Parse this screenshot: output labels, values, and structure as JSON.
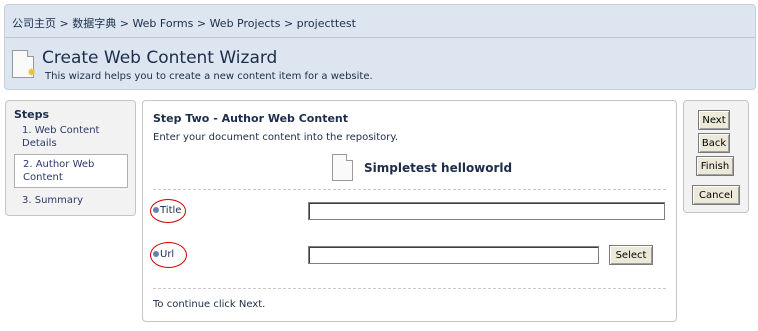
{
  "breadcrumb": {
    "items": [
      "公司主页",
      "数据字典",
      "Web Forms",
      "Web Projects",
      "projecttest"
    ],
    "separator": ">"
  },
  "wizard": {
    "title": "Create Web Content Wizard",
    "description": "This wizard helps you to create a new content item for a website."
  },
  "steps": {
    "heading": "Steps",
    "items": [
      {
        "label": "1. Web Content Details"
      },
      {
        "label": "2. Author Web Content"
      },
      {
        "label": "3. Summary"
      }
    ],
    "active_index": 1
  },
  "main": {
    "step_title": "Step Two - Author Web Content",
    "step_description": "Enter your document content into the repository.",
    "document_name": "Simpletest helloworld",
    "fields": {
      "title": {
        "label": "Title",
        "value": ""
      },
      "url": {
        "label": "Url",
        "value": "",
        "select_label": "Select"
      }
    },
    "continue_text": "To continue click Next."
  },
  "buttons": {
    "next": "Next",
    "back": "Back",
    "finish": "Finish",
    "cancel": "Cancel"
  },
  "colors": {
    "header_bg": "#dde6f0",
    "title_text": "#1c2d4a",
    "annotation_red": "#d00000"
  }
}
